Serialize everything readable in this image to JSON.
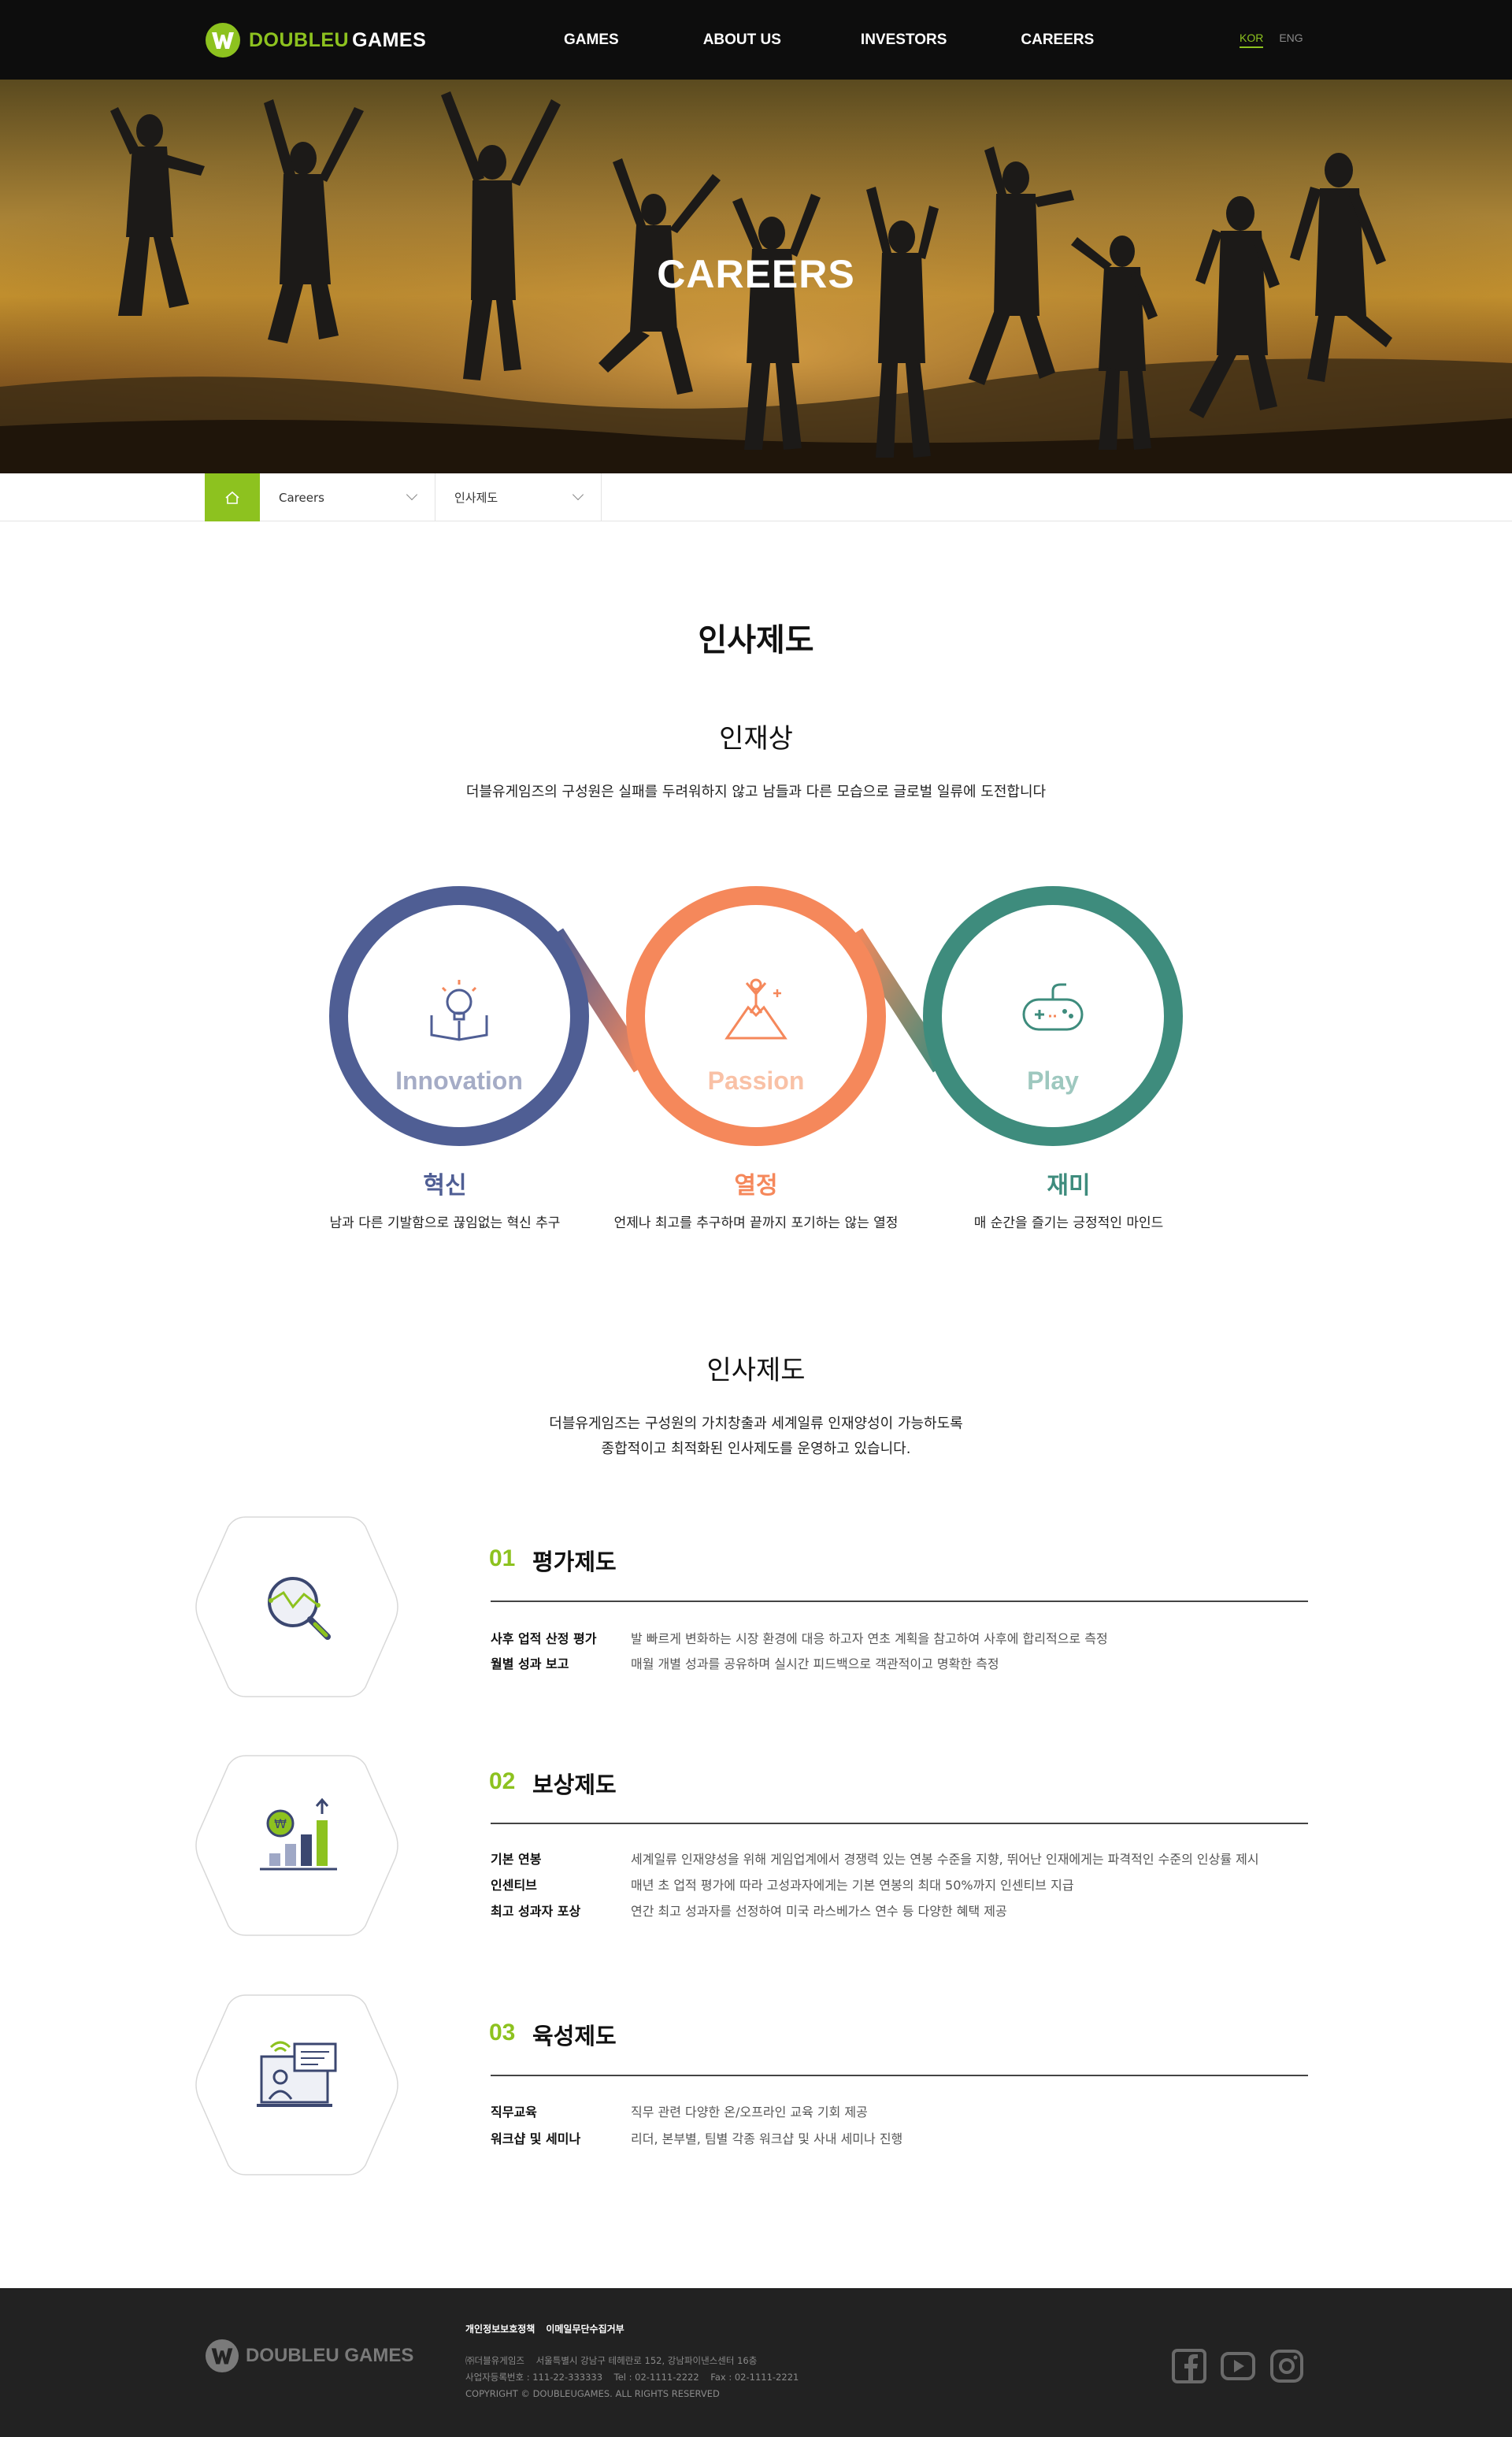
{
  "header": {
    "logo_part1": "DOUBLEU",
    "logo_part2": "GAMES",
    "nav": [
      "GAMES",
      "ABOUT US",
      "INVESTORS",
      "CAREERS"
    ],
    "lang_kor": "KOR",
    "lang_eng": "ENG"
  },
  "hero": {
    "title": "CAREERS"
  },
  "breadcrumb": {
    "level1": "Careers",
    "level2": "인사제도"
  },
  "page": {
    "title": "인사제도",
    "talent": {
      "heading": "인재상",
      "desc": "더블유게임즈의 구성원은 실패를 두려워하지 않고 남들과 다른 모습으로 글로벌 일류에 도전합니다",
      "values": [
        {
          "word": "Innovation",
          "title": "혁신",
          "desc": "남과 다른 기발함으로 끊임없는 혁신 추구",
          "color": "#4f5e94"
        },
        {
          "word": "Passion",
          "title": "열정",
          "desc": "언제나 최고를 추구하며 끝까지 포기하는 않는 열정",
          "color": "#f5885b"
        },
        {
          "word": "Play",
          "title": "재미",
          "desc": "매 순간을 즐기는 긍정적인 마인드",
          "color": "#3e8c7d"
        }
      ]
    },
    "system": {
      "heading": "인사제도",
      "desc_line1": "더블유게임즈는 구성원의 가치창출과 세계일류 인재양성이 가능하도록",
      "desc_line2": "종합적이고 최적화된 인사제도를 운영하고 있습니다.",
      "items": [
        {
          "num": "01",
          "title": "평가제도",
          "icon": "magnifier-chart-icon",
          "rows": [
            {
              "k": "사후 업적 산정 평가",
              "v": "발 빠르게 변화하는 시장 환경에 대응 하고자 연초 계획을 참고하여 사후에 합리적으로 측정"
            },
            {
              "k": "월별 성과 보고",
              "v": "매월 개별 성과를 공유하며 실시간 피드백으로 객관적이고 명확한 측정"
            }
          ]
        },
        {
          "num": "02",
          "title": "보상제도",
          "icon": "coin-bar-chart-icon",
          "rows": [
            {
              "k": "기본 연봉",
              "v": "세계일류 인재양성을 위해 게임업계에서 경쟁력 있는 연봉 수준을 지향, 뛰어난 인재에게는 파격적인 수준의 인상률 제시"
            },
            {
              "k": "인센티브",
              "v": "매년 초 업적 평가에 따라 고성과자에게는 기본 연봉의 최대 50%까지 인센티브 지급"
            },
            {
              "k": "최고 성과자 포상",
              "v": "연간 최고 성과자를 선정하여 미국 라스베가스 연수 등 다양한 혜택 제공"
            }
          ]
        },
        {
          "num": "03",
          "title": "육성제도",
          "icon": "online-training-icon",
          "rows": [
            {
              "k": "직무교육",
              "v": "직무 관련 다양한 온/오프라인 교육 기회 제공"
            },
            {
              "k": "워크샵 및 세미나",
              "v": "리더, 본부별, 팀별 각종 워크샵 및 사내 세미나 진행"
            }
          ]
        }
      ]
    }
  },
  "footer": {
    "logo_part1": "DOUBLEU",
    "logo_part2": "GAMES",
    "link_privacy": "개인정보보호정책",
    "link_email": "이메일무단수집거부",
    "info_line1": "㈜더블유게임즈    서울특별시 강남구 테헤란로 152, 강남파이낸스센터 16층",
    "info_line2": "사업자등록번호 : 111-22-333333    Tel : 02-1111-2222    Fax : 02-1111-2221",
    "info_line3": "COPYRIGHT © DOUBLEUGAMES. ALL RIGHTS RESERVED",
    "social": [
      "facebook-icon",
      "youtube-icon",
      "instagram-icon"
    ]
  },
  "colors": {
    "brand_green": "#8dc21f",
    "header_bg": "#0d0d0d",
    "footer_bg": "#222222"
  }
}
